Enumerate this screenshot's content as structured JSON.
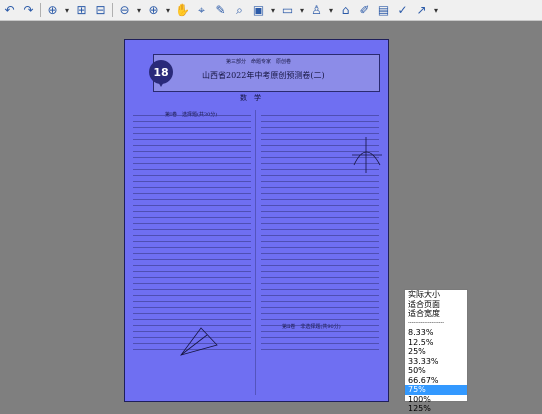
{
  "toolbar": {
    "icons": [
      "undo-icon",
      "redo-icon",
      "zoom-in-icon",
      "fit-page-icon",
      "zoom-out-icon",
      "add-icon",
      "hand-icon",
      "select-icon",
      "highlight-icon",
      "binoculars-icon",
      "image-icon",
      "window-icon",
      "stamp-icon",
      "attach-icon",
      "edit-icon",
      "note-icon",
      "check-icon",
      "arrow-icon"
    ]
  },
  "page": {
    "number": "18",
    "header_line": "第三部分　命题专家　原创卷",
    "title": "山西省2022年中考原创预测卷(二)",
    "subject": "数　学",
    "section1": "第Ⅰ卷　选择题(共30分)",
    "section2": "第Ⅱ卷　非选择题(共90分)"
  },
  "zoom_menu": {
    "items": [
      "实际大小",
      "适合页面",
      "适合宽度",
      "--------------------",
      "8.33%",
      "12.5%",
      "25%",
      "33.33%",
      "50%",
      "66.67%",
      "75%",
      "100%",
      "125%"
    ],
    "selected": "75%"
  },
  "colors": {
    "page": "#6f6ff2",
    "toolbar": "#f0f0f0",
    "highlight": "#3399ff"
  }
}
